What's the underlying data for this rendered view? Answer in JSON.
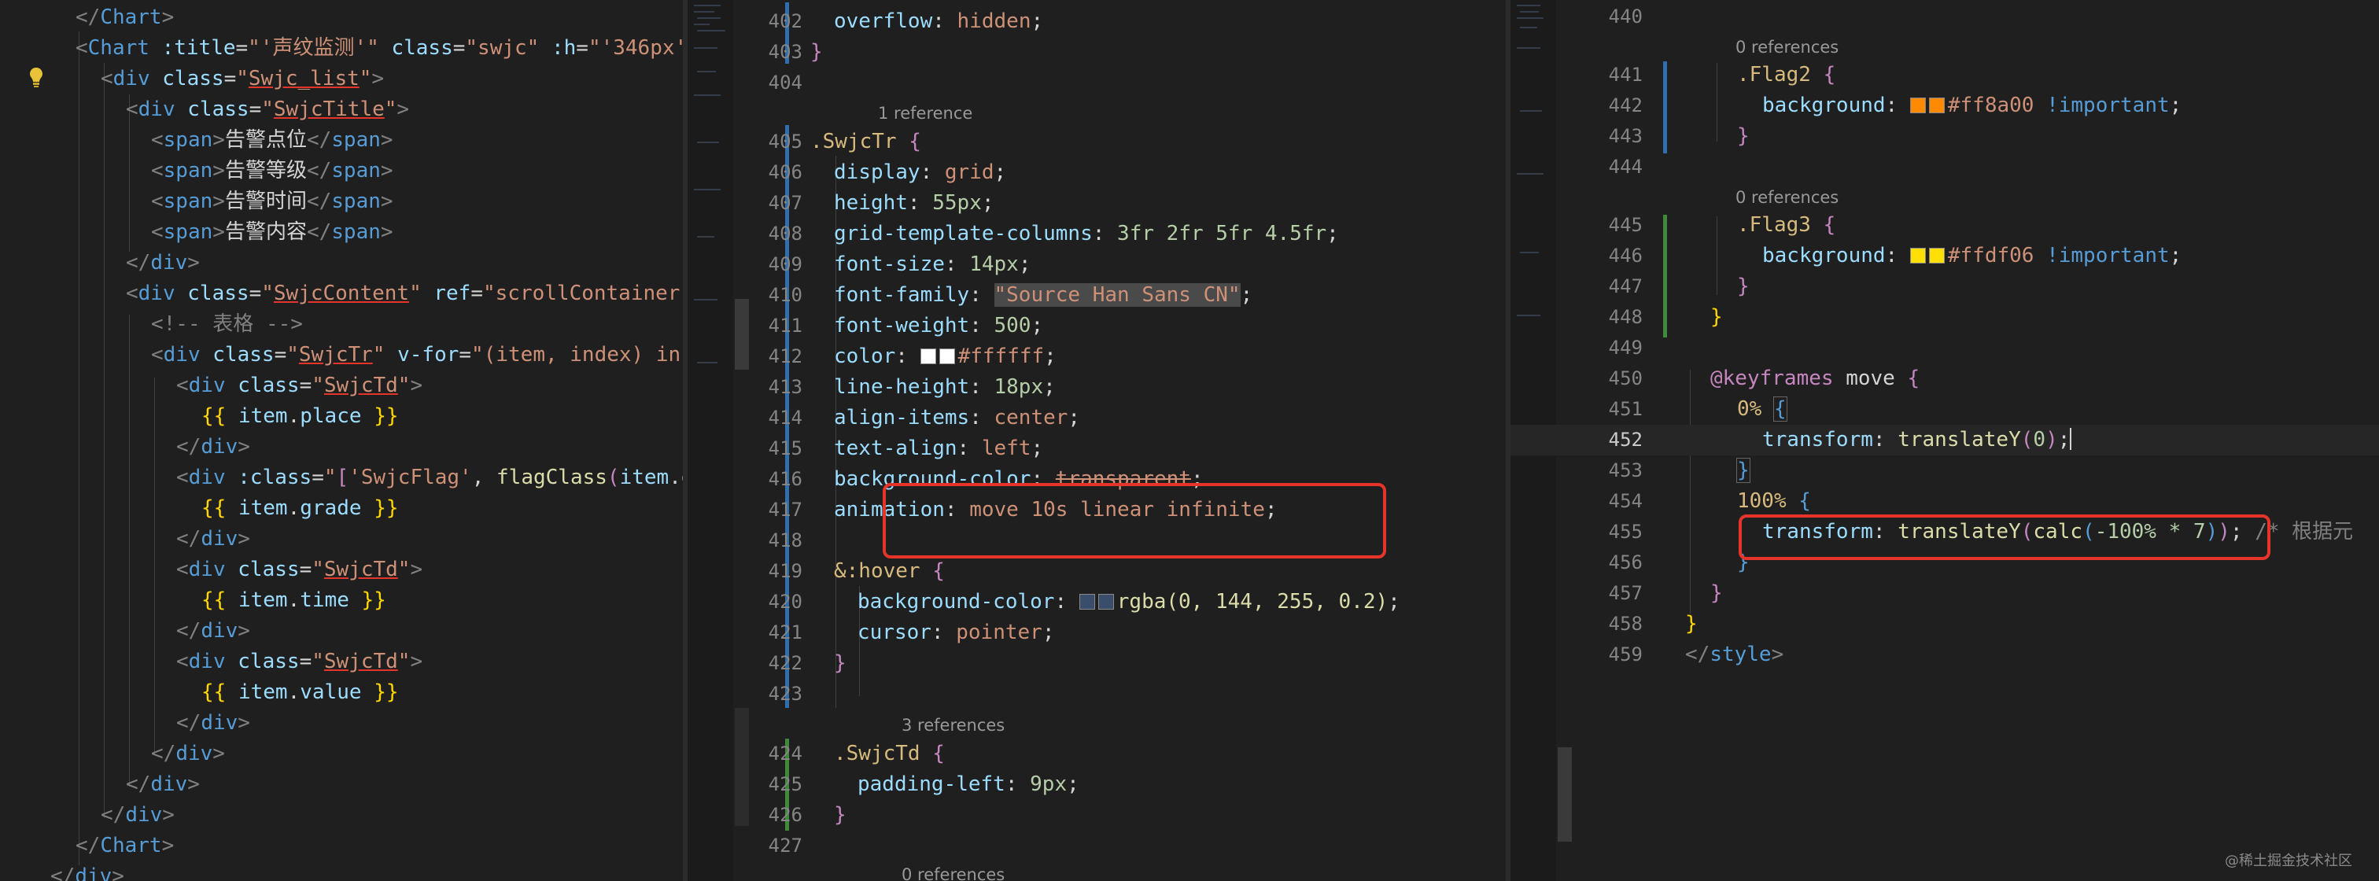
{
  "left": {
    "lines": [
      "</Chart>",
      "<Chart :title=\"'声纹监测'\" class=\"swjc\" :h=\"'346px'",
      "<div class=\"Swjc_list\">",
      "<div class=\"SwjcTitle\">",
      "<span>告警点位</span>",
      "<span>告警等级</span>",
      "<span>告警时间</span>",
      "<span>告警内容</span>",
      "</div>",
      "<div class=\"SwjcContent\" ref=\"scrollContainer\"",
      "<!-- 表格 -->",
      "<div class=\"SwjcTr\" v-for=\"(item, index) in",
      "<div class=\"SwjcTd\">",
      "{{ item.place }}",
      "</div>",
      "<div :class=\"['SwjcFlag', flagClass(item.g",
      "{{ item.grade }}",
      "</div>",
      "<div class=\"SwjcTd\">",
      "{{ item.time }}",
      "</div>",
      "<div class=\"SwjcTd\">",
      "{{ item.value }}",
      "</div>",
      "</div>",
      "</div>",
      "</div>",
      "</Chart>",
      "</div>"
    ]
  },
  "middle": {
    "line_numbers": [
      "402",
      "403",
      "404",
      "405",
      "406",
      "407",
      "408",
      "409",
      "410",
      "411",
      "412",
      "413",
      "414",
      "415",
      "416",
      "417",
      "418",
      "419",
      "420",
      "421",
      "422",
      "423",
      "424",
      "425",
      "426",
      "427"
    ],
    "refs": [
      "1 reference",
      "3 references",
      "0 references"
    ],
    "lines": {
      "l402_prop": "overflow",
      "l402_val": "hidden",
      "l405_sel": ".SwjcTr",
      "l406_prop": "display",
      "l406_val": "grid",
      "l407_prop": "height",
      "l407_val": "55px",
      "l408_prop": "grid-template-columns",
      "l408_val": "3fr 2fr 5fr 4.5fr",
      "l409_prop": "font-size",
      "l409_val": "14px",
      "l410_prop": "font-family",
      "l410_val": "\"Source Han Sans CN\"",
      "l411_prop": "font-weight",
      "l411_val": "500",
      "l412_prop": "color",
      "l412_val": "#ffffff",
      "l413_prop": "line-height",
      "l413_val": "18px",
      "l414_prop": "align-items",
      "l414_val": "center",
      "l415_prop": "text-align",
      "l415_val": "left",
      "l416_prop": "background-color",
      "l416_val": "transparent",
      "l417_prop": "animation",
      "l417_val": "move 10s linear infinite",
      "l419_sel": "&:hover",
      "l420_prop": "background-color",
      "l420_val": "rgba(0, 144, 255, 0.2)",
      "l421_prop": "cursor",
      "l421_val": "pointer",
      "l424_sel": ".SwjcTd",
      "l425_prop": "padding-left",
      "l425_val": "9px"
    }
  },
  "right": {
    "line_numbers": [
      "440",
      "441",
      "442",
      "443",
      "444",
      "445",
      "446",
      "447",
      "448",
      "449",
      "450",
      "451",
      "452",
      "453",
      "454",
      "455",
      "456",
      "457",
      "458",
      "459"
    ],
    "current_line": "452",
    "refs": [
      "0 references",
      "0 references"
    ],
    "lines": {
      "l441_sel": ".Flag2",
      "l442_prop": "background",
      "l442_val": "#ff8a00",
      "l442_imp": "!important",
      "l445_sel": ".Flag3",
      "l446_prop": "background",
      "l446_val": "#ffdf06",
      "l446_imp": "!important",
      "l450_kw": "@keyframes",
      "l450_name": "move",
      "l451_sel": "0%",
      "l452_prop": "transform",
      "l452_fn": "translateY",
      "l452_arg": "0",
      "l454_sel": "100%",
      "l455_prop": "transform",
      "l455_fn": "translateY",
      "l455_fn2": "calc",
      "l455_arg": "-100% * 7",
      "l455_comment": "/* 根据元",
      "l459_tag": "</style>"
    }
  },
  "colors": {
    "swatch_white": "#ffffff",
    "swatch_orange": "#ff8a00",
    "swatch_yellow": "#ffdf06",
    "swatch_blue": "#3a4d6b",
    "highlight_box": "#e5352b"
  },
  "icons": {
    "lightbulb": "lightbulb-icon"
  },
  "watermark": "@稀土掘金技术社区"
}
